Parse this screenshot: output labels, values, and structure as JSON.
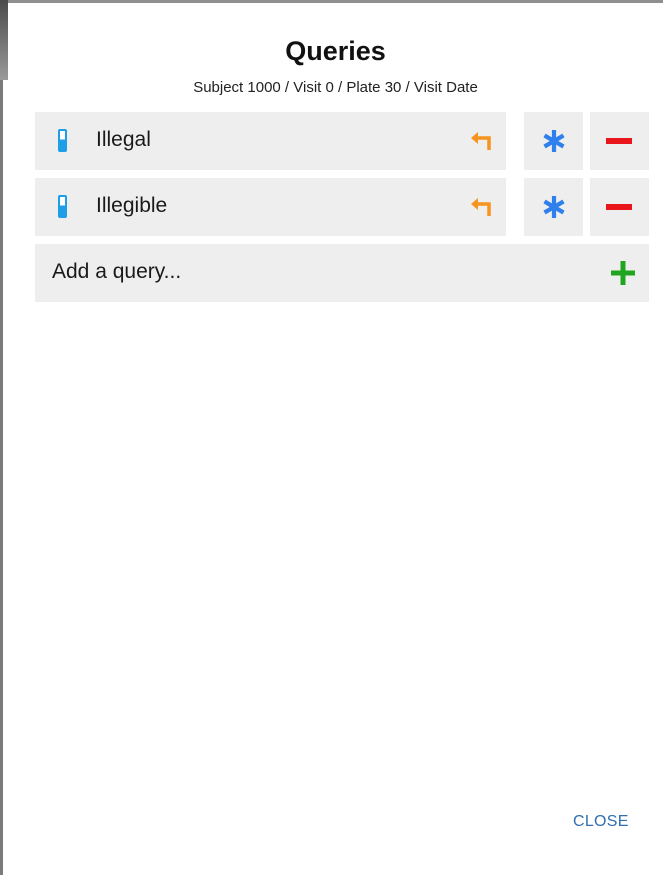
{
  "dialog": {
    "title": "Queries",
    "subtitle": "Subject 1000 / Visit 0 / Plate 30 / Visit Date"
  },
  "queries": [
    {
      "label": "Illegal",
      "level_icon": "battery-level-icon",
      "reply_icon": "reply-arrow-icon",
      "edit_icon": "asterisk-icon",
      "delete_icon": "minus-icon"
    },
    {
      "label": "Illegible",
      "level_icon": "battery-level-icon",
      "reply_icon": "reply-arrow-icon",
      "edit_icon": "asterisk-icon",
      "delete_icon": "minus-icon"
    }
  ],
  "add_query": {
    "placeholder": "Add a query...",
    "icon": "plus-icon"
  },
  "footer": {
    "close_label": "CLOSE"
  },
  "colors": {
    "row_background": "#eeeeee",
    "level_blue": "#1e9ee6",
    "reply_orange": "#f7941d",
    "asterisk_blue": "#2f80ed",
    "delete_red": "#e8151b",
    "add_green": "#1fa51f",
    "close_link": "#2f6fb0"
  }
}
